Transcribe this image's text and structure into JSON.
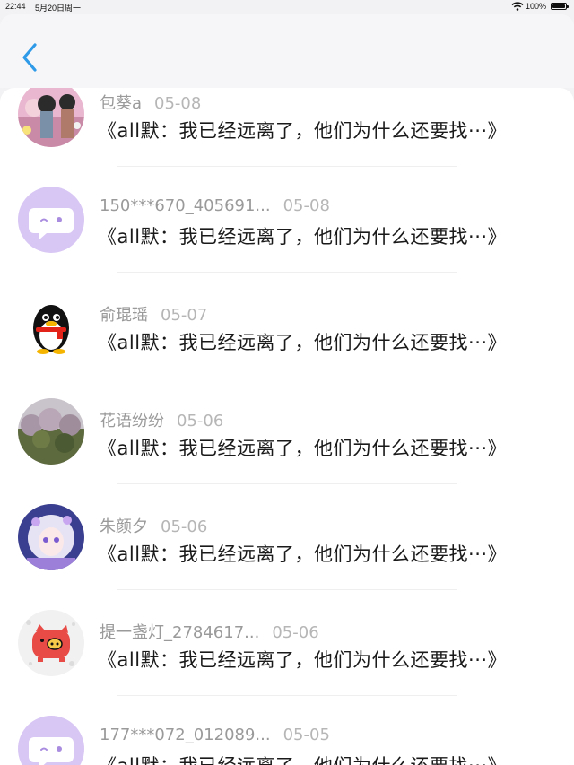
{
  "status_bar": {
    "time": "22:44",
    "date": "5月20日周一",
    "battery": "100%"
  },
  "nav": {
    "back_icon": "chevron-left-icon",
    "accent": "#2f9be8"
  },
  "items": [
    {
      "name": "包葵a",
      "date": "05-08",
      "title": "《all默：我已经远离了，他们为什么还要找···》"
    },
    {
      "name": "150***670_405691...",
      "date": "05-08",
      "title": "《all默：我已经远离了，他们为什么还要找···》"
    },
    {
      "name": "俞琨瑶",
      "date": "05-07",
      "title": "《all默：我已经远离了，他们为什么还要找···》"
    },
    {
      "name": "花语纷纷",
      "date": "05-06",
      "title": "《all默：我已经远离了，他们为什么还要找···》"
    },
    {
      "name": "朱颜夕",
      "date": "05-06",
      "title": "《all默：我已经远离了，他们为什么还要找···》"
    },
    {
      "name": "提一盏灯_2784617...",
      "date": "05-06",
      "title": "《all默：我已经远离了，他们为什么还要找···》"
    },
    {
      "name": "177***072_012089...",
      "date": "05-05",
      "title": "《all默：我已经远离了，他们为什么还要找···》"
    }
  ]
}
